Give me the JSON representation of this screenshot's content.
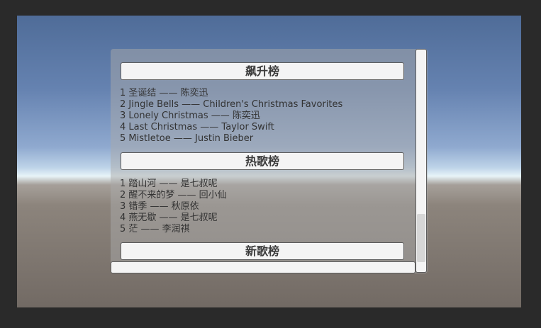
{
  "sections": [
    {
      "title": "飙升榜",
      "items": [
        "1 圣诞结 —— 陈奕迅",
        "2 Jingle Bells —— Children's Christmas Favorites",
        "3 Lonely Christmas —— 陈奕迅",
        "4 Last Christmas —— Taylor Swift",
        "5 Mistletoe —— Justin Bieber"
      ]
    },
    {
      "title": "热歌榜",
      "items": [
        "1 踏山河 —— 是七叔呢",
        "2 醒不来的梦 —— 回小仙",
        "3 错季 —— 秋原依",
        "4 燕无歇 —— 是七叔呢",
        "5 茫 —— 李润祺"
      ]
    },
    {
      "title": "新歌榜"
    }
  ]
}
